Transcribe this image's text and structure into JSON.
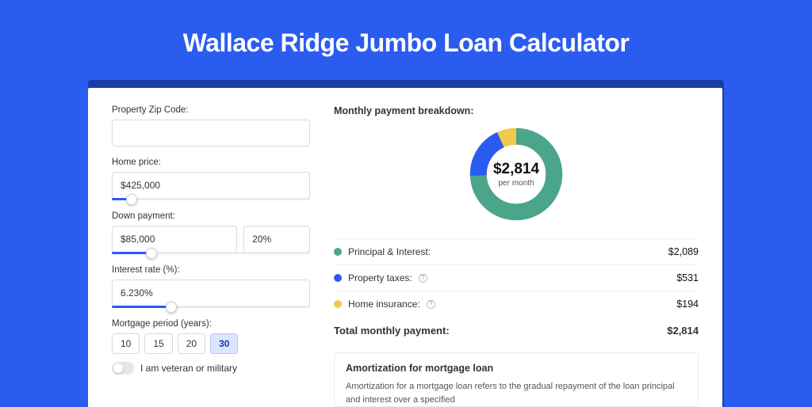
{
  "page_title": "Wallace Ridge Jumbo Loan Calculator",
  "left": {
    "zip_label": "Property Zip Code:",
    "zip_value": "",
    "home_price_label": "Home price:",
    "home_price_value": "$425,000",
    "down_label": "Down payment:",
    "down_value": "$85,000",
    "down_pct_value": "20%",
    "rate_label": "Interest rate (%):",
    "rate_value": "6.230%",
    "period_label": "Mortgage period (years):",
    "periods": [
      "10",
      "15",
      "20",
      "30"
    ],
    "period_selected": "30",
    "veteran_label": "I am veteran or military"
  },
  "right": {
    "breakdown_title": "Monthly payment breakdown:",
    "donut_amount": "$2,814",
    "donut_sub": "per month",
    "items": [
      {
        "name": "Principal & Interest:",
        "value": "$2,089",
        "color": "teal",
        "info": false
      },
      {
        "name": "Property taxes:",
        "value": "$531",
        "color": "blue",
        "info": true
      },
      {
        "name": "Home insurance:",
        "value": "$194",
        "color": "yellow",
        "info": true
      }
    ],
    "total_label": "Total monthly payment:",
    "total_value": "$2,814",
    "amort_title": "Amortization for mortgage loan",
    "amort_text": "Amortization for a mortgage loan refers to the gradual repayment of the loan principal and interest over a specified"
  },
  "chart_data": {
    "type": "pie",
    "title": "Monthly payment breakdown",
    "series": [
      {
        "name": "Principal & Interest",
        "value": 2089,
        "color": "#4aa58a"
      },
      {
        "name": "Property taxes",
        "value": 531,
        "color": "#2b5cf0"
      },
      {
        "name": "Home insurance",
        "value": 194,
        "color": "#f2c94c"
      }
    ],
    "total": 2814,
    "center_label": "$2,814",
    "center_sublabel": "per month"
  }
}
